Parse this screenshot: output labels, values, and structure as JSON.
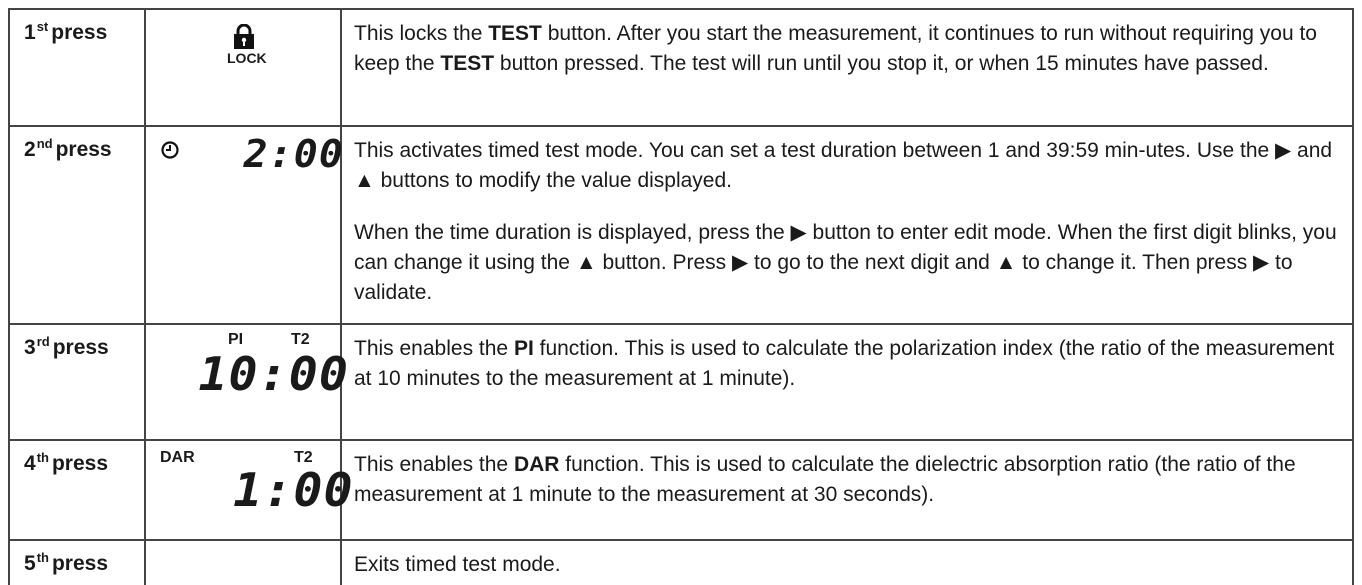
{
  "rows": [
    {
      "press_num": "1",
      "press_sup": "st",
      "press_word": "press",
      "icon_label": "LOCK",
      "text": [
        {
          "t": "This locks the "
        },
        {
          "b": "TEST"
        },
        {
          "t": " button. After you start the measurement, it continues to run without requiring you to keep the "
        },
        {
          "b": "TEST"
        },
        {
          "t": " button pressed. The test will run until you stop it, or when 15 minutes have passed."
        }
      ]
    },
    {
      "press_num": "2",
      "press_sup": "nd",
      "press_word": "press",
      "display": "2:00",
      "para1": "This activates timed test mode. You can set a test duration between 1 and 39:59 min-utes. Use the ▶ and ▲ buttons to modify the value displayed.",
      "para2": "When the time duration is displayed, press the ▶ button to enter edit mode. When the first digit blinks, you can change it using the ▲ button. Press ▶ to go to the next digit and ▲ to change it.  Then press ▶ to validate."
    },
    {
      "press_num": "3",
      "press_sup": "rd",
      "press_word": "press",
      "label_left": "PI",
      "label_right": "T2",
      "display": "10:00",
      "text": [
        {
          "t": "This enables the "
        },
        {
          "b": "PI"
        },
        {
          "t": " function. This is used to calculate the polarization index (the ratio of the measurement at 10 minutes to the measurement at 1 minute)."
        }
      ]
    },
    {
      "press_num": "4",
      "press_sup": "th",
      "press_word": "press",
      "label_left": "DAR",
      "label_right": "T2",
      "display": "1:00",
      "text": [
        {
          "t": "This enables the "
        },
        {
          "b": "DAR"
        },
        {
          "t": " function. This is used to calculate the dielectric absorption ratio (the ratio of the measurement at 1 minute to the measurement at 30 seconds)."
        }
      ]
    },
    {
      "press_num": "5",
      "press_sup": "th",
      "press_word": "press",
      "text": [
        {
          "t": "Exits timed test mode."
        }
      ]
    }
  ]
}
